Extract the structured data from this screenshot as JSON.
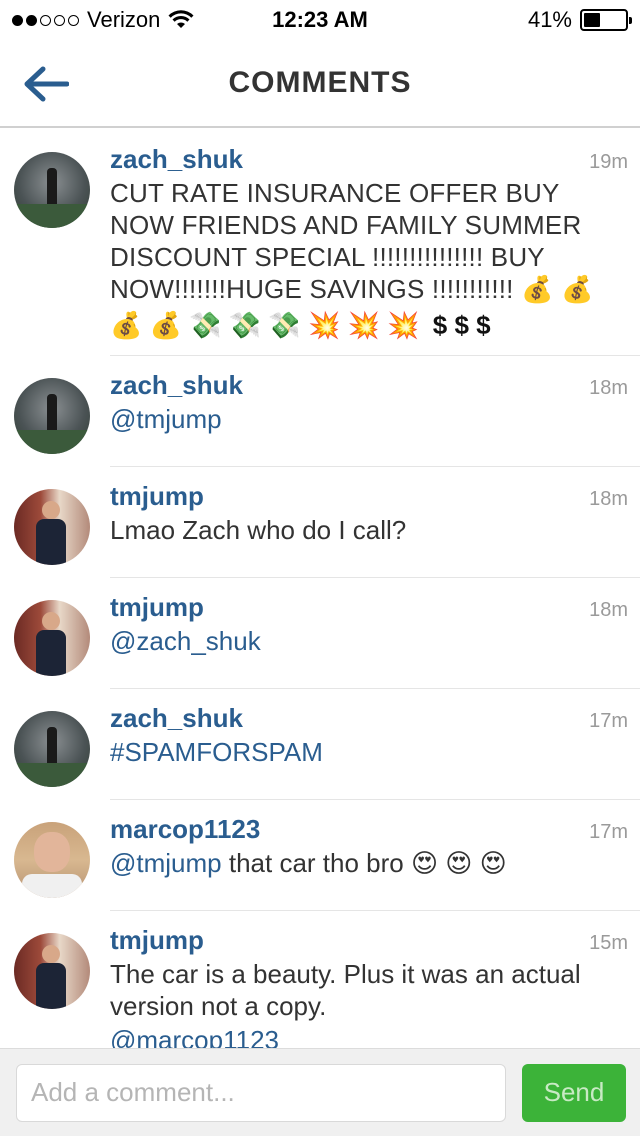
{
  "status_bar": {
    "carrier": "Verizon",
    "time": "12:23 AM",
    "battery_percent": "41%",
    "battery_level": 0.41,
    "signal_bars": 2,
    "signal_total": 5
  },
  "nav": {
    "title": "COMMENTS",
    "back_icon": "back-arrow-icon"
  },
  "comments": [
    {
      "username": "zach_shuk",
      "time": "19m",
      "text": "CUT RATE INSURANCE OFFER BUY NOW FRIENDS AND FAMILY SUMMER DISCOUNT SPECIAL !!!!!!!!!!!!!!! BUY NOW!!!!!!!HUGE SAVINGS !!!!!!!!!!! 💰 💰",
      "emoji_line": "💰 💰 💸 💸 💸 💥 💥 💥",
      "dollars": "$ $ $"
    },
    {
      "username": "zach_shuk",
      "time": "18m",
      "text": "@tmjump"
    },
    {
      "username": "tmjump",
      "time": "18m",
      "text": "Lmao Zach who do I call?"
    },
    {
      "username": "tmjump",
      "time": "18m",
      "text": "@zach_shuk"
    },
    {
      "username": "zach_shuk",
      "time": "17m",
      "text": "#SPAMFORSPAM"
    },
    {
      "username": "marcop1123",
      "time": "17m",
      "mention": "@tmjump",
      "text": " that car tho bro 😍 😍 😍"
    },
    {
      "username": "tmjump",
      "time": "15m",
      "text": "The car is a beauty.  Plus it was an actual version not a copy.",
      "mention": "@marcop1123"
    }
  ],
  "composer": {
    "placeholder": "Add a comment...",
    "send_label": "Send",
    "send_color": "#3cb339"
  }
}
